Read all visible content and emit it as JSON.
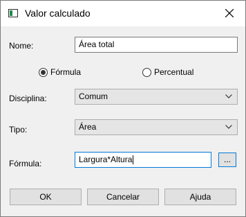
{
  "window": {
    "title": "Valor calculado",
    "app_icon": "dialog-app-icon",
    "close_icon": "close-icon"
  },
  "form": {
    "nome": {
      "label": "Nome:",
      "value": "Área total"
    },
    "mode": {
      "options": [
        {
          "label": "Fórmula",
          "checked": true
        },
        {
          "label": "Percentual",
          "checked": false
        }
      ]
    },
    "disciplina": {
      "label": "Disciplina:",
      "selected": "Comum"
    },
    "tipo": {
      "label": "Tipo:",
      "selected": "Área"
    },
    "formula": {
      "label": "Fórmula:",
      "value": "Largura*Altura",
      "browse_label": "..."
    }
  },
  "buttons": {
    "ok": "OK",
    "cancel": "Cancelar",
    "help": "Ajuda"
  },
  "colors": {
    "focus_border": "#0078d7",
    "dialog_bg": "#f0f0f0"
  }
}
